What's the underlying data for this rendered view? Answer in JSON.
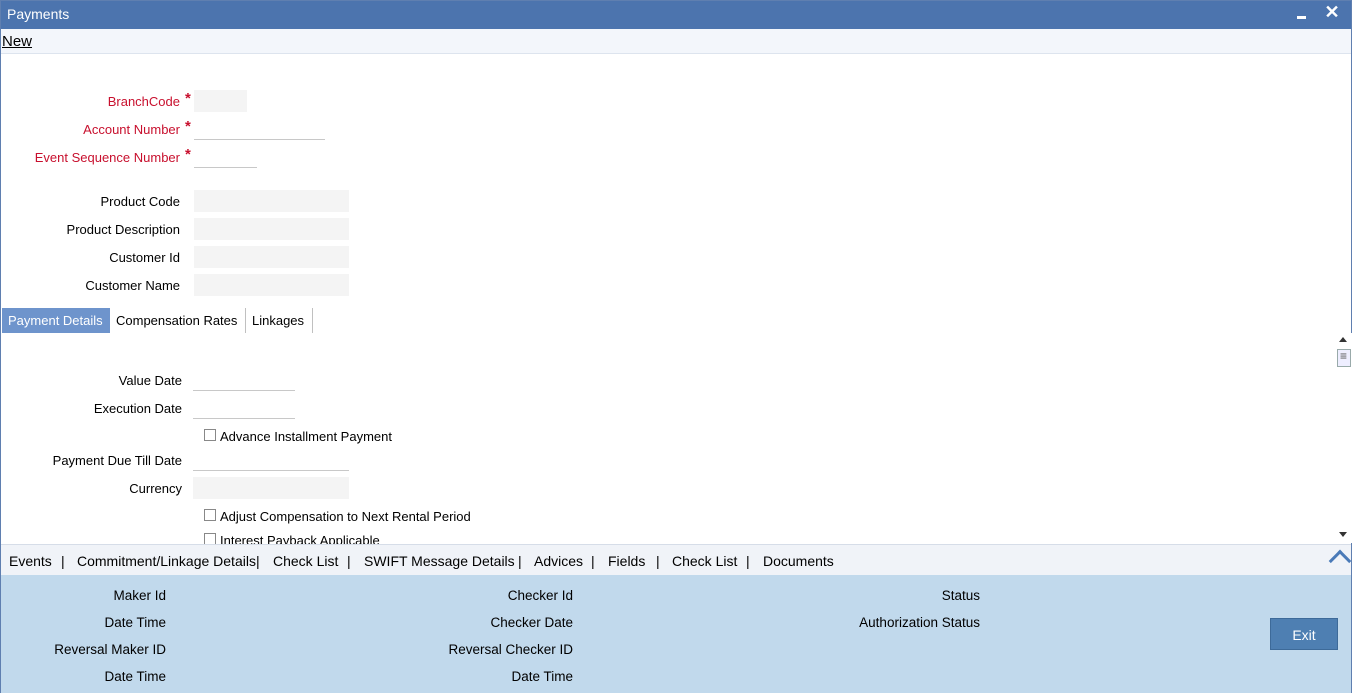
{
  "window": {
    "title": "Payments"
  },
  "menu": {
    "new_label": "New"
  },
  "header_fields": {
    "branch_code_label": "BranchCode",
    "account_number_label": "Account Number",
    "event_sequence_label": "Event Sequence Number",
    "product_code_label": "Product Code",
    "product_description_label": "Product Description",
    "customer_id_label": "Customer Id",
    "customer_name_label": "Customer Name",
    "required_marker": "*"
  },
  "tabs": [
    {
      "label": "Payment Details",
      "active": true
    },
    {
      "label": "Compensation Rates",
      "active": false
    },
    {
      "label": "Linkages",
      "active": false
    }
  ],
  "payment_details": {
    "value_date_label": "Value Date",
    "execution_date_label": "Execution Date",
    "advance_installment_label": "Advance Installment Payment",
    "payment_due_till_label": "Payment Due Till Date",
    "currency_label": "Currency",
    "adjust_compensation_label": "Adjust Compensation to Next Rental Period",
    "interest_payback_label": "Interest Payback Applicable"
  },
  "footer_nav": [
    "Events",
    "Commitment/Linkage Details",
    "Check List",
    "SWIFT Message Details",
    "Advices",
    "Fields",
    "Check List",
    "Documents"
  ],
  "footer_sep": "|",
  "audit": {
    "maker_id": "Maker Id",
    "date_time_1": "Date Time",
    "reversal_maker_id": "Reversal Maker ID",
    "date_time_2": "Date Time",
    "checker_id": "Checker Id",
    "checker_date": "Checker Date",
    "reversal_checker_id": "Reversal Checker ID",
    "date_time_3": "Date Time",
    "status": "Status",
    "authorization_status": "Authorization Status"
  },
  "buttons": {
    "exit": "Exit",
    "close_glyph": "✕"
  },
  "colors": {
    "titlebar": "#4c74ae",
    "required": "#c8102e",
    "active_tab": "#6e94cc",
    "audit_bg": "#c1d9ec",
    "exit_button": "#4e7fb2"
  }
}
